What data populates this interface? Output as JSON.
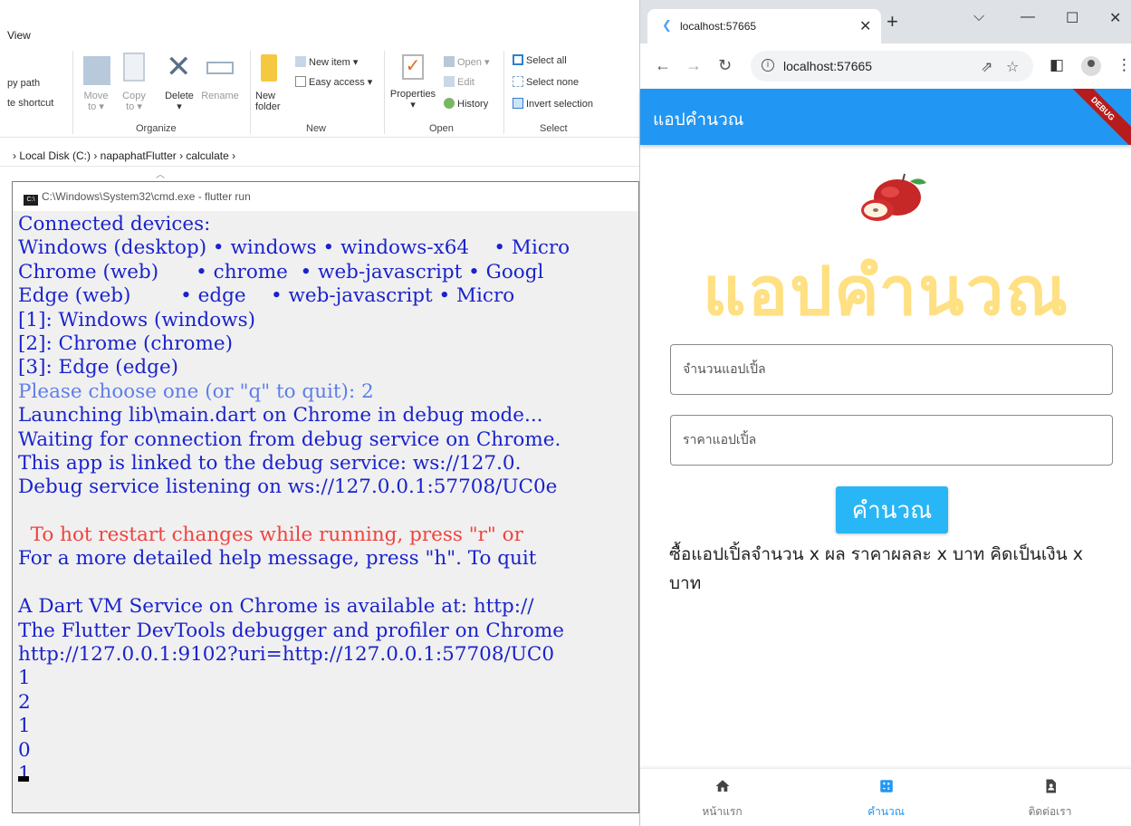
{
  "explorer": {
    "view_tab": "View",
    "clipboard": {
      "copy_path": "py path",
      "paste_shortcut": "te shortcut"
    },
    "organize": {
      "move_to": "Move\nto ▾",
      "copy_to": "Copy\nto ▾",
      "delete": "Delete\n▾",
      "rename": "Rename",
      "group_label": "Organize"
    },
    "new": {
      "new_item": "New item ▾",
      "easy_access": "Easy access ▾",
      "new_folder": "New\nfolder",
      "group_label": "New"
    },
    "open": {
      "properties": "Properties\n▾",
      "open": "Open ▾",
      "edit": "Edit",
      "history": "History",
      "group_label": "Open"
    },
    "select": {
      "select_all": "Select all",
      "select_none": "Select none",
      "invert_selection": "Invert selection",
      "group_label": "Select"
    },
    "breadcrumb": "›  Local Disk (C:)  ›  napaphatFlutter  ›  calculate  ›"
  },
  "cmd": {
    "title": "C:\\Windows\\System32\\cmd.exe - flutter  run",
    "lines": [
      {
        "text": "Connected devices:",
        "color": "blue"
      },
      {
        "text": "Windows (desktop) • windows • windows-x64    • Micro",
        "color": "blue"
      },
      {
        "text": "Chrome (web)      • chrome  • web-javascript • Googl",
        "color": "blue"
      },
      {
        "text": "Edge (web)        • edge    • web-javascript • Micro",
        "color": "blue"
      },
      {
        "text": "[1]: Windows (windows)",
        "color": "blue"
      },
      {
        "text": "[2]: Chrome (chrome)",
        "color": "blue"
      },
      {
        "text": "[3]: Edge (edge)",
        "color": "blue"
      },
      {
        "text": "Please choose one (or \"q\" to quit): 2",
        "color": "cyan"
      },
      {
        "text": "Launching lib\\main.dart on Chrome in debug mode...",
        "color": "blue"
      },
      {
        "text": "Waiting for connection from debug service on Chrome.",
        "color": "blue"
      },
      {
        "text": "This app is linked to the debug service: ws://127.0.",
        "color": "blue"
      },
      {
        "text": "Debug service listening on ws://127.0.0.1:57708/UC0e",
        "color": "blue"
      },
      {
        "text": "",
        "color": "blue"
      },
      {
        "text": "  To hot restart changes while running, press \"r\" or",
        "color": "red"
      },
      {
        "text": "For a more detailed help message, press \"h\". To quit",
        "color": "blue"
      },
      {
        "text": "",
        "color": "blue"
      },
      {
        "text": "A Dart VM Service on Chrome is available at: http://",
        "color": "blue"
      },
      {
        "text": "The Flutter DevTools debugger and profiler on Chrome",
        "color": "blue"
      },
      {
        "text": "http://127.0.0.1:9102?uri=http://127.0.0.1:57708/UC0",
        "color": "blue"
      },
      {
        "text": "1",
        "color": "blue"
      },
      {
        "text": "2",
        "color": "blue"
      },
      {
        "text": "1",
        "color": "blue"
      },
      {
        "text": "0",
        "color": "blue"
      },
      {
        "text": "1",
        "color": "blue"
      }
    ]
  },
  "chrome": {
    "tab_title": "localhost:57665",
    "url": "localhost:57665",
    "window_controls": {
      "dropdown": "⌵",
      "minimize": "—",
      "maximize": "☐",
      "close": "✕"
    }
  },
  "app": {
    "appbar_title": "แอปคำนวณ",
    "debug_label": "DEBUG",
    "big_title": "แอปคำนวณ",
    "apple_count_placeholder": "จำนวนแอปเปิ้ล",
    "apple_price_placeholder": "ราคาแอปเปิ้ล",
    "calculate_button": "คำนวณ",
    "result_text": "ซื้อแอปเปิ้ลจำนวน x ผล ราคาผลละ x บาท คิดเป็นเงิน x บาท",
    "colors": {
      "primary": "#2196f3",
      "title_yellow": "#ffe082",
      "button": "#29b6f6"
    }
  },
  "bottom_nav": {
    "items": [
      {
        "label": "หน้าแรก",
        "icon": "home-icon",
        "active": false
      },
      {
        "label": "คำนวณ",
        "icon": "calculator-icon",
        "active": true
      },
      {
        "label": "ติดต่อเรา",
        "icon": "contact-icon",
        "active": false
      }
    ]
  }
}
